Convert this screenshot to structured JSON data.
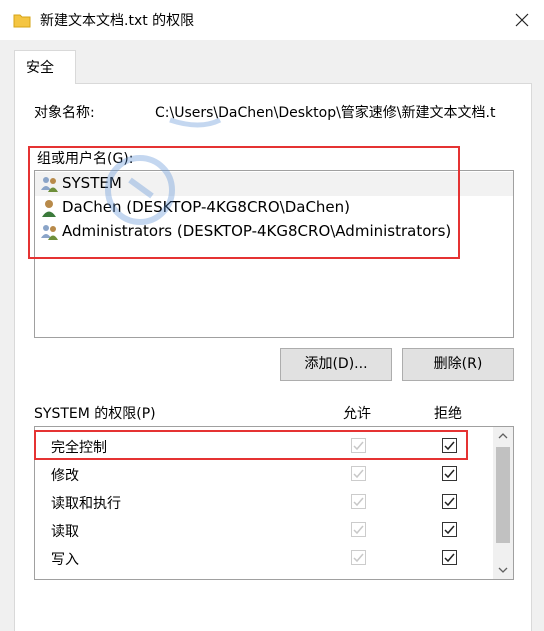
{
  "window": {
    "title": "新建文本文档.txt 的权限"
  },
  "tabs": [
    {
      "label": "安全"
    }
  ],
  "object": {
    "label": "对象名称:",
    "value": "C:\\Users\\DaChen\\Desktop\\管家速修\\新建文本文档.t"
  },
  "groups": {
    "label": "组或用户名(G):",
    "items": [
      {
        "name": "SYSTEM",
        "icon": "group-users-icon"
      },
      {
        "name": "DaChen (DESKTOP-4KG8CRO\\DaChen)",
        "icon": "user-icon"
      },
      {
        "name": "Administrators (DESKTOP-4KG8CRO\\Administrators)",
        "icon": "group-users-icon"
      }
    ]
  },
  "buttons": {
    "add": "添加(D)...",
    "remove": "删除(R)"
  },
  "permissions": {
    "header": "SYSTEM 的权限(P)",
    "allow_header": "允许",
    "deny_header": "拒绝",
    "rows": [
      {
        "label": "完全控制",
        "allow": true,
        "deny": true
      },
      {
        "label": "修改",
        "allow": true,
        "deny": true
      },
      {
        "label": "读取和执行",
        "allow": true,
        "deny": true
      },
      {
        "label": "读取",
        "allow": true,
        "deny": true
      },
      {
        "label": "写入",
        "allow": true,
        "deny": true
      }
    ]
  },
  "colors": {
    "highlight_box": "#e53333",
    "allow_disabled": "#c8c8c8"
  }
}
